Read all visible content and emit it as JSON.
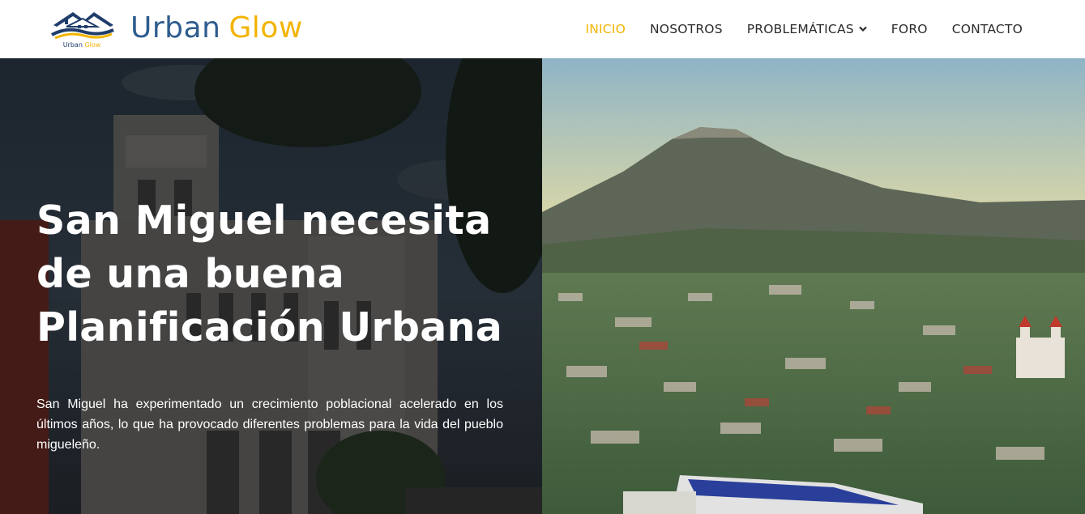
{
  "brand": {
    "logo_caption": "Urban Glow",
    "word1": "Urban",
    "word2": "Glow"
  },
  "nav": {
    "items": [
      {
        "label": "INICIO",
        "active": true
      },
      {
        "label": "NOSOTROS",
        "active": false
      },
      {
        "label": "PROBLEMÁTICAS",
        "active": false,
        "icon": "chevron-down-icon"
      },
      {
        "label": "FORO",
        "active": false
      },
      {
        "label": "CONTACTO",
        "active": false
      }
    ]
  },
  "hero": {
    "headline": "San Miguel necesita de una buena Planificación Urbana",
    "lead": "San Miguel ha experimentado un crecimiento poblacional acelerado en los últimos años, lo que ha provocado diferentes problemas para la vida del pueblo migueleño."
  },
  "colors": {
    "brand_blue": "#2e5c8e",
    "accent_yellow": "#f2b400",
    "nav_text": "#2b2b2b"
  }
}
